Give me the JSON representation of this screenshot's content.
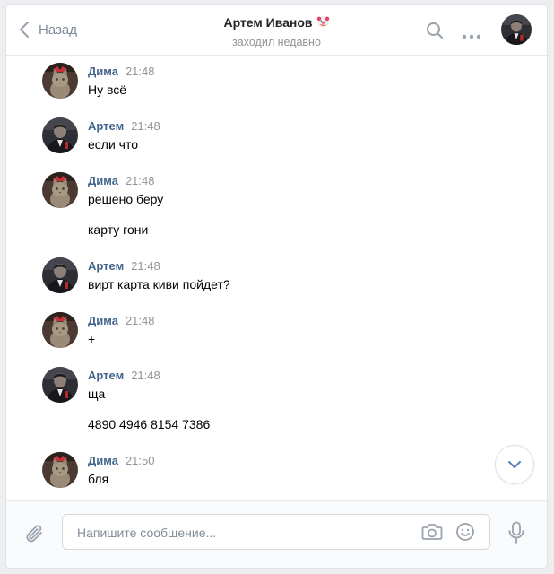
{
  "header": {
    "back_label": "Назад",
    "title": "Артем Иванов",
    "subtitle": "заходил недавно"
  },
  "messages": [
    {
      "author": "Дима",
      "time": "21:48",
      "avatar": "cat",
      "lines": [
        "Ну всё"
      ]
    },
    {
      "author": "Артем",
      "time": "21:48",
      "avatar": "suit",
      "lines": [
        "если что"
      ]
    },
    {
      "author": "Дима",
      "time": "21:48",
      "avatar": "cat",
      "lines": [
        "решено беру",
        "карту гони"
      ]
    },
    {
      "author": "Артем",
      "time": "21:48",
      "avatar": "suit",
      "lines": [
        "вирт карта киви пойдет?"
      ]
    },
    {
      "author": "Дима",
      "time": "21:48",
      "avatar": "cat",
      "lines": [
        "+"
      ]
    },
    {
      "author": "Артем",
      "time": "21:48",
      "avatar": "suit",
      "lines": [
        "ща",
        "4890 4946 8154 7386"
      ]
    },
    {
      "author": "Дима",
      "time": "21:50",
      "avatar": "cat",
      "lines": [
        "бля"
      ]
    }
  ],
  "composer": {
    "placeholder": "Напишите сообщение...",
    "value": ""
  },
  "icons": {
    "back": "chevron-left-icon",
    "title_emoji": "clown-face-icon",
    "search": "search-icon",
    "more": "more-horizontal-icon",
    "scroll_down": "chevron-down-icon",
    "attach": "paperclip-icon",
    "camera": "camera-icon",
    "emoji": "smile-icon",
    "voice": "microphone-icon"
  },
  "colors": {
    "author_link": "#42648b",
    "muted_text": "#939393",
    "icon_gray": "#99a2ad",
    "page_bg": "#edeef0"
  }
}
